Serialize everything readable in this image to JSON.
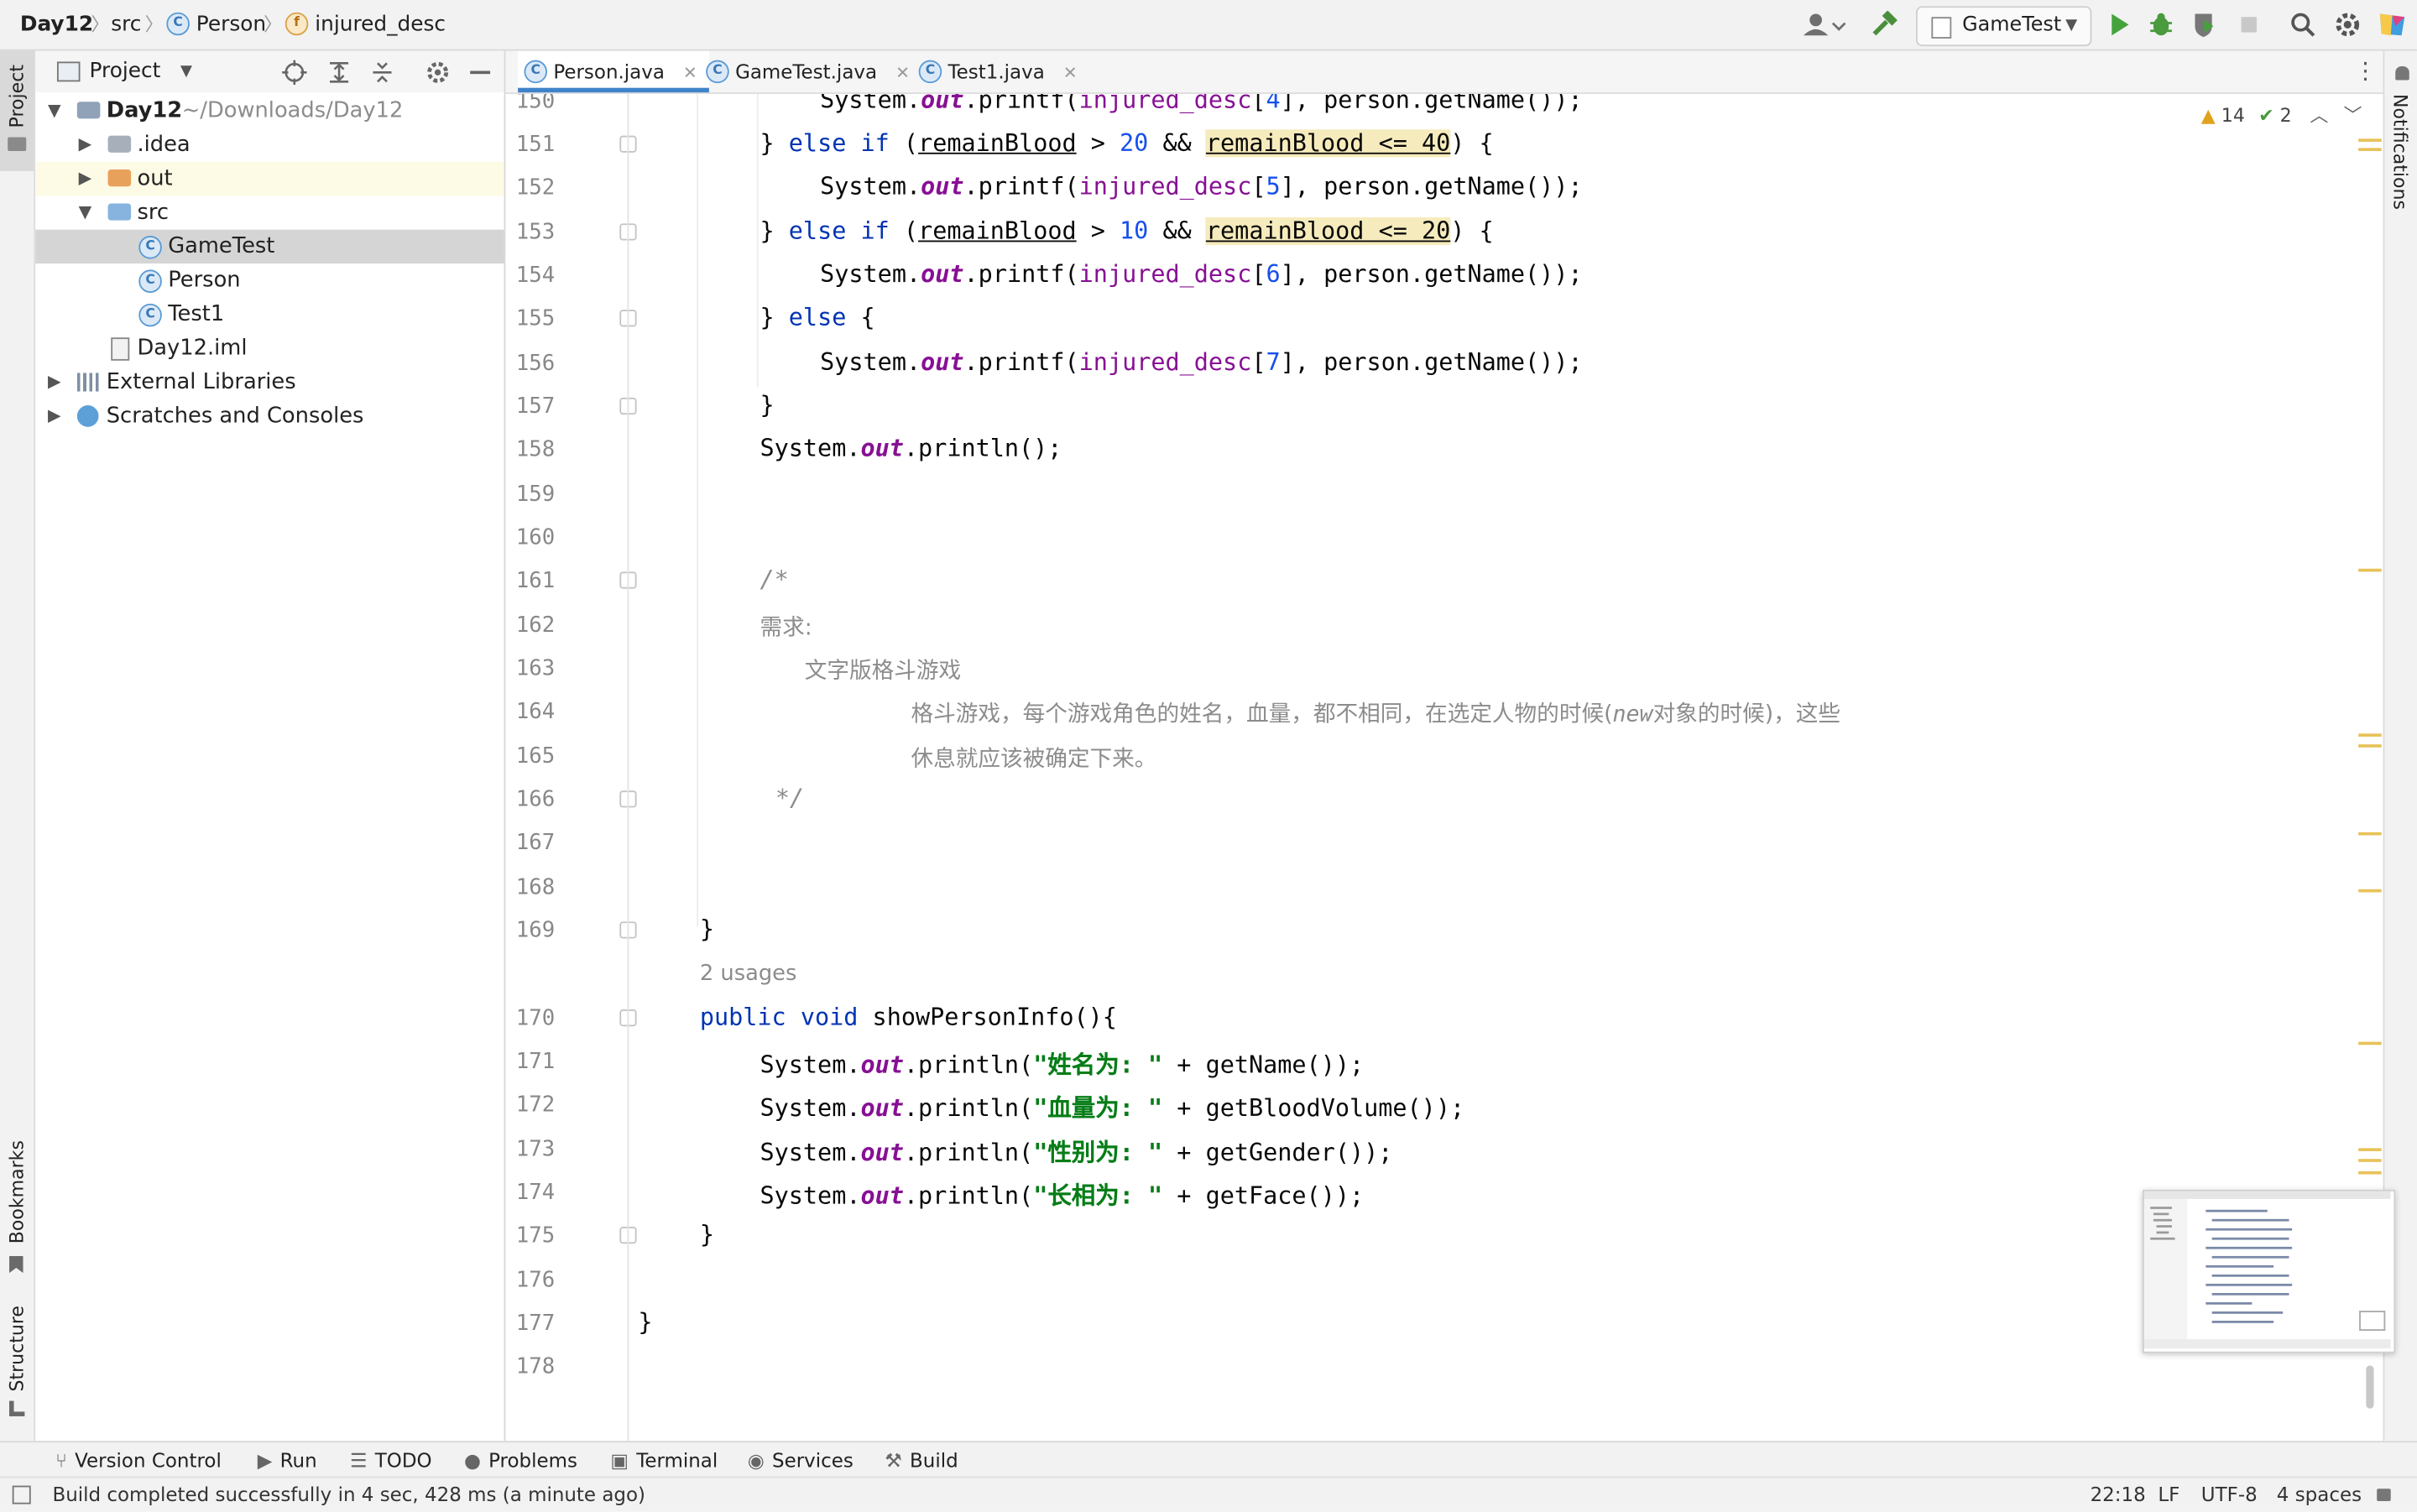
{
  "breadcrumb": {
    "project": "Day12",
    "folder": "src",
    "class": "Person",
    "field": "injured_desc"
  },
  "toolbar": {
    "run_config": "GameTest"
  },
  "left_strip": {
    "project_tab": "Project",
    "bookmarks_tab": "Bookmarks",
    "structure_tab": "Structure"
  },
  "right_strip": {
    "notifications_tab": "Notifications"
  },
  "project_panel": {
    "title": "Project",
    "tree": [
      {
        "label": "Day12",
        "suffix": "~/Downloads/Day12"
      },
      {
        "label": ".idea"
      },
      {
        "label": "out"
      },
      {
        "label": "src"
      },
      {
        "label": "GameTest"
      },
      {
        "label": "Person"
      },
      {
        "label": "Test1"
      },
      {
        "label": "Day12.iml"
      },
      {
        "label": "External Libraries"
      },
      {
        "label": "Scratches and Consoles"
      }
    ]
  },
  "editor_tabs": [
    {
      "label": "Person.java",
      "active": true
    },
    {
      "label": "GameTest.java",
      "active": false
    },
    {
      "label": "Test1.java",
      "active": false
    }
  ],
  "inspections": {
    "warnings": "14",
    "weak_warnings": "2"
  },
  "editor": {
    "line_numbers": [
      "150",
      "151",
      "152",
      "153",
      "154",
      "155",
      "156",
      "157",
      "158",
      "159",
      "160",
      "161",
      "162",
      "163",
      "164",
      "165",
      "166",
      "167",
      "168",
      "169",
      "170",
      "171",
      "172",
      "173",
      "174",
      "175",
      "176",
      "177",
      "178"
    ],
    "usages_hint": "2 usages",
    "comment": {
      "open": "/*",
      "line1": "需求:",
      "line2": "文字版格斗游戏",
      "line3a": "格斗游戏，每个游戏角色的姓名，血量，都不相同，在选定人物的时候(",
      "line3b": "new",
      "line3c": "对象的时候)，这些",
      "line4": "休息就应该被确定下来。",
      "close": "*/"
    },
    "strings": {
      "name": "\"姓名为: \"",
      "blood": "\"血量为: \"",
      "gender": "\"性别为: \"",
      "face": "\"长相为: \""
    }
  },
  "bottom_tools": [
    {
      "label": "Version Control"
    },
    {
      "label": "Run"
    },
    {
      "label": "TODO"
    },
    {
      "label": "Problems"
    },
    {
      "label": "Terminal"
    },
    {
      "label": "Services"
    },
    {
      "label": "Build"
    }
  ],
  "status": {
    "message": "Build completed successfully in 4 sec, 428 ms (a minute ago)",
    "position": "22:18",
    "line_sep": "LF",
    "encoding": "UTF-8",
    "indent": "4 spaces"
  }
}
